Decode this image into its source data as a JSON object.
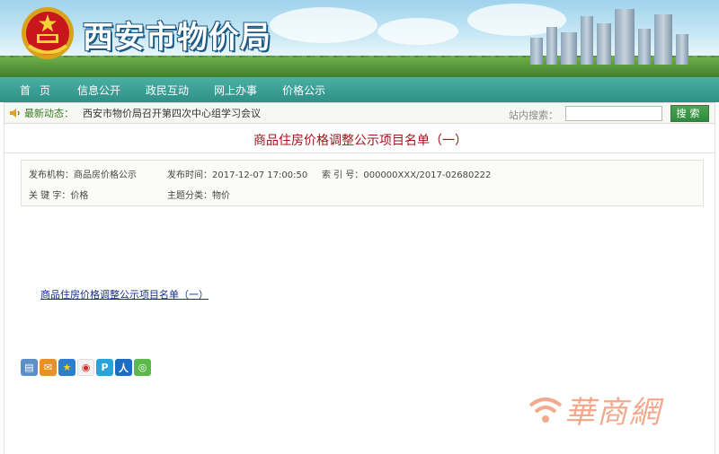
{
  "header": {
    "site_title": "西安市物价局"
  },
  "nav": {
    "items": [
      "首页",
      "信息公开",
      "政民互动",
      "网上办事",
      "价格公示"
    ]
  },
  "newsbar": {
    "label": "最新动态：",
    "headline": "西安市物价局召开第四次中心组学习会议",
    "search_label": "站内搜索：",
    "search_value": "",
    "search_button": "搜索"
  },
  "article": {
    "title": "商品住房价格调整公示项目名单（一）",
    "meta": {
      "publisher": "发布机构：商品房价格公示",
      "publish_time": "发布时间：2017-12-07 17:00:50",
      "index_no": "索 引 号：000000XXX/2017-02680222",
      "keywords": "关 键 字：价格",
      "category": "主题分类：物价"
    },
    "link_text": "商品住房价格调整公示项目名单（一）"
  },
  "share_icons": [
    "print-icon",
    "email-icon",
    "qzone-star-icon",
    "weibo-icon",
    "tencent-weibo-icon",
    "renren-icon",
    "wechat-icon"
  ],
  "colors": {
    "nav_bg": "#3aa198",
    "title_red": "#a1141b",
    "search_btn": "#3a9a47",
    "link": "#1a2c8c"
  },
  "watermark": {
    "text": "華商網"
  }
}
